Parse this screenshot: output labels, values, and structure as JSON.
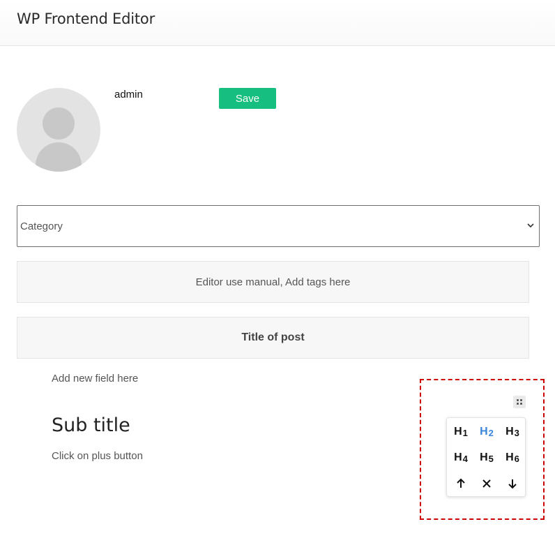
{
  "header": {
    "title": "WP Frontend Editor"
  },
  "profile": {
    "username": "admin",
    "save_label": "Save"
  },
  "form": {
    "category_value": "Category",
    "tags_text": "Editor use manual, Add tags here",
    "post_title": "Title of post",
    "add_field_text": "Add new field here",
    "subtitle": "Sub title",
    "hint": "Click on plus button"
  },
  "heading_toolbar": {
    "buttons": [
      {
        "h": "H",
        "n": "1"
      },
      {
        "h": "H",
        "n": "2"
      },
      {
        "h": "H",
        "n": "3"
      },
      {
        "h": "H",
        "n": "4"
      },
      {
        "h": "H",
        "n": "5"
      },
      {
        "h": "H",
        "n": "6"
      }
    ],
    "active": "H2",
    "active_color": "#3a86d8",
    "actions": [
      "move-up",
      "remove",
      "move-down"
    ]
  },
  "colors": {
    "save_button": "#16bf7f",
    "selection_outline": "#cc0000"
  }
}
